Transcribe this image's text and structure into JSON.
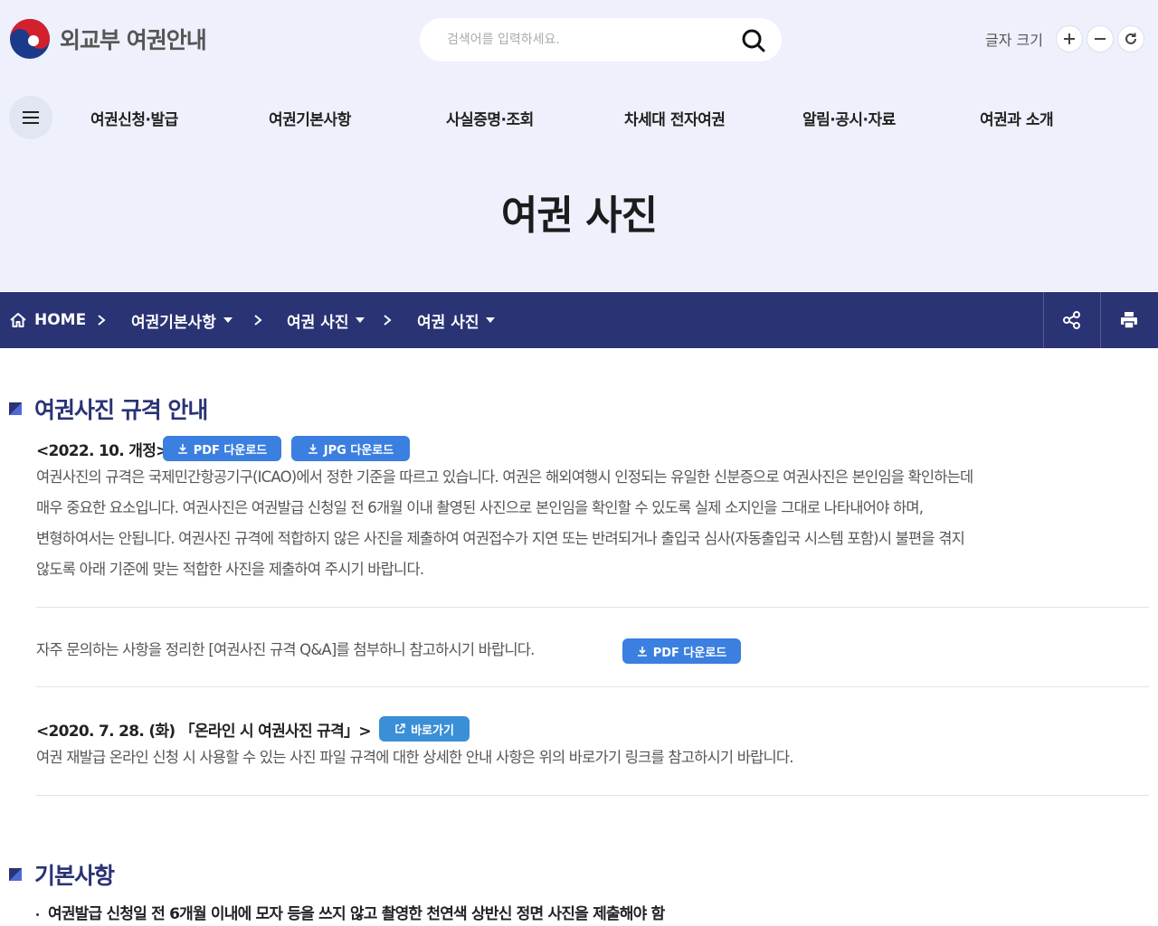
{
  "header": {
    "logo_text": "외교부 여권안내",
    "search_placeholder": "검색어를 입력하세요.",
    "font_size_label": "글자 크기"
  },
  "gnb": [
    "여권신청·발급",
    "여권기본사항",
    "사실증명·조회",
    "차세대 전자여권",
    "알림·공시·자료",
    "여권과 소개"
  ],
  "page_title": "여권 사진",
  "breadcrumb": {
    "home": "HOME",
    "items": [
      "여권기본사항",
      "여권 사진",
      "여권 사진"
    ]
  },
  "section1": {
    "title": "여권사진 규격 안내",
    "revision": "<2022. 10. 개정>",
    "pdf_button": "PDF 다운로드",
    "jpg_button": "JPG 다운로드",
    "paragraph_lines": [
      "여권사진의 규격은 국제민간항공기구(ICAO)에서 정한 기준을 따르고 있습니다. 여권은 해외여행시 인정되는 유일한 신분증으로 여권사진은 본인임을 확인하는데",
      "매우 중요한 요소입니다. 여권사진은 여권발급 신청일 전 6개월 이내 촬영된 사진으로 본인임을 확인할 수 있도록 실제 소지인을 그대로 나타내어야 하며,",
      "변형하여서는 안됩니다. 여권사진 규격에 적합하지 않은 사진을 제출하여 여권접수가 지연 또는 반려되거나 출입국 심사(자동출입국 시스템 포함)시 불편을 겪지",
      "않도록 아래 기준에 맞는 적합한 사진을 제출하여 주시기 바랍니다."
    ],
    "qa_text": "자주 문의하는 사항을 정리한 [여권사진 규격 Q&A]를 첨부하니 참고하시기 바랍니다.",
    "qa_button": "PDF 다운로드",
    "online_title": "<2020. 7. 28. (화) 「온라인 시 여권사진 규격」>",
    "online_button": "바로가기",
    "online_text": "여권 재발급 온라인 신청 시 사용할 수 있는 사진 파일 규격에 대한 상세한 안내 사항은 위의 바로가기 링크를 참고하시기 바랍니다."
  },
  "section2": {
    "title": "기본사항",
    "bullet1": "여권발급 신청일 전 6개월 이내에 모자 등을 쓰지 않고 촬영한 천연색 상반신 정면 사진을 제출해야 함"
  },
  "colors": {
    "header_bg": "#eef0fb",
    "breadcrumb_bg": "#2a3374",
    "accent_navy": "#2a3374",
    "button_blue": "#3b7fe0"
  },
  "icons": [
    "hamburger-icon",
    "search-icon",
    "plus-icon",
    "minus-icon",
    "refresh-icon",
    "home-icon",
    "share-icon",
    "print-icon",
    "download-icon",
    "external-link-icon"
  ]
}
